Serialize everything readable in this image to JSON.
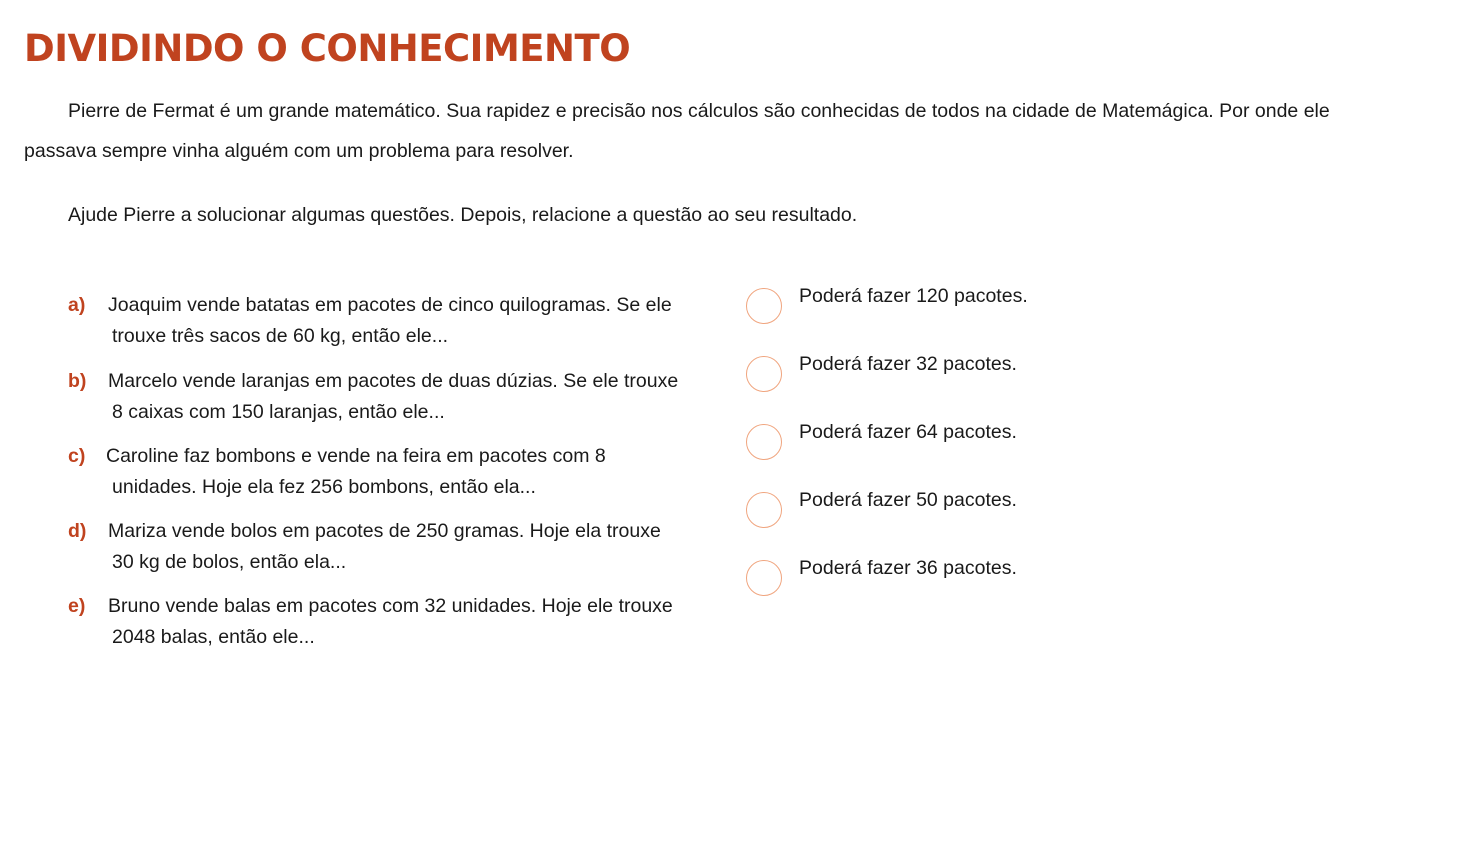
{
  "title": "DIVIDINDO O CONHECIMENTO",
  "intro": "Pierre de Fermat é um grande matemático. Sua rapidez e precisão nos cálculos são conhecidas de todos na cidade de Matemágica. Por onde ele passava sempre vinha alguém com um problema para resolver.",
  "instruction": "Ajude Pierre a solucionar algumas questões. Depois, relacione a questão ao seu resultado.",
  "questions": [
    {
      "letter": "a)",
      "line1": "Joaquim vende batatas em pacotes de cinco quilogramas. Se ele",
      "line2": "trouxe três sacos de 60 kg, então ele..."
    },
    {
      "letter": "b)",
      "line1": "Marcelo vende laranjas em pacotes de duas dúzias. Se ele trouxe",
      "line2": "8 caixas com 150 laranjas, então ele..."
    },
    {
      "letter": "c)",
      "line1": "Caroline faz bombons e vende na feira em pacotes com 8",
      "line2": "unidades. Hoje ela fez 256 bombons, então ela..."
    },
    {
      "letter": "d)",
      "line1": "Mariza vende bolos em pacotes de 250 gramas. Hoje ela trouxe",
      "line2": "30 kg de bolos, então ela..."
    },
    {
      "letter": "e)",
      "line1": "Bruno vende balas em pacotes com 32 unidades. Hoje ele trouxe",
      "line2": "2048 balas, então ele..."
    }
  ],
  "answers": [
    {
      "label": "Poderá fazer 120 pacotes.",
      "value": ""
    },
    {
      "label": "Poderá fazer 32 pacotes.",
      "value": ""
    },
    {
      "label": "Poderá fazer 64 pacotes.",
      "value": ""
    },
    {
      "label": "Poderá fazer 50 pacotes.",
      "value": ""
    },
    {
      "label": "Poderá fazer 36 pacotes.",
      "value": ""
    }
  ],
  "colors": {
    "accent": "#c0431f",
    "circle_border": "#f0a57f",
    "text": "#1a1a1a"
  }
}
